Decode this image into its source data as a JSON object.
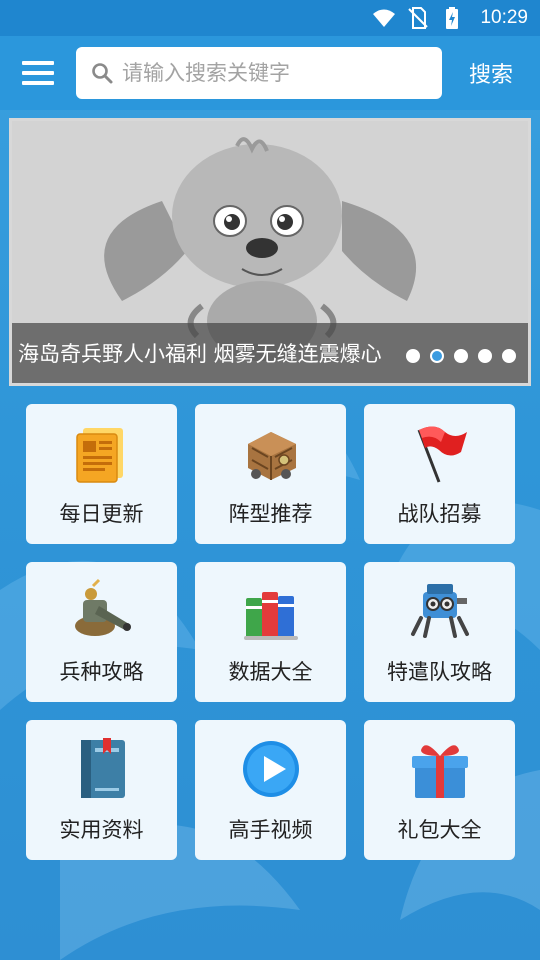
{
  "status_bar": {
    "time": "10:29",
    "icons": [
      "wifi-icon",
      "no-sim-icon",
      "battery-charging-icon"
    ]
  },
  "header": {
    "menu_icon": "menu-icon",
    "search_placeholder": "请输入搜索关键字",
    "search_value": "",
    "search_button": "搜索"
  },
  "banner": {
    "title": "海岛奇兵野人小福利 烟雾无缝连震爆心",
    "slides": 5,
    "active_slide": 2
  },
  "grid": {
    "items": [
      {
        "label": "每日更新",
        "icon": "newspaper-icon"
      },
      {
        "label": "阵型推荐",
        "icon": "supply-crate-icon"
      },
      {
        "label": "战队招募",
        "icon": "red-flag-icon"
      },
      {
        "label": "兵种攻略",
        "icon": "cannon-icon"
      },
      {
        "label": "数据大全",
        "icon": "books-icon"
      },
      {
        "label": "特遣队攻略",
        "icon": "robot-tank-icon"
      },
      {
        "label": "实用资料",
        "icon": "notebook-icon"
      },
      {
        "label": "高手视频",
        "icon": "play-video-icon"
      },
      {
        "label": "礼包大全",
        "icon": "gift-box-icon"
      }
    ]
  },
  "colors": {
    "header": "#2b97dc",
    "status_bar": "#1f86cf",
    "background": "#3aa0df",
    "tile": "#eef7fd"
  }
}
